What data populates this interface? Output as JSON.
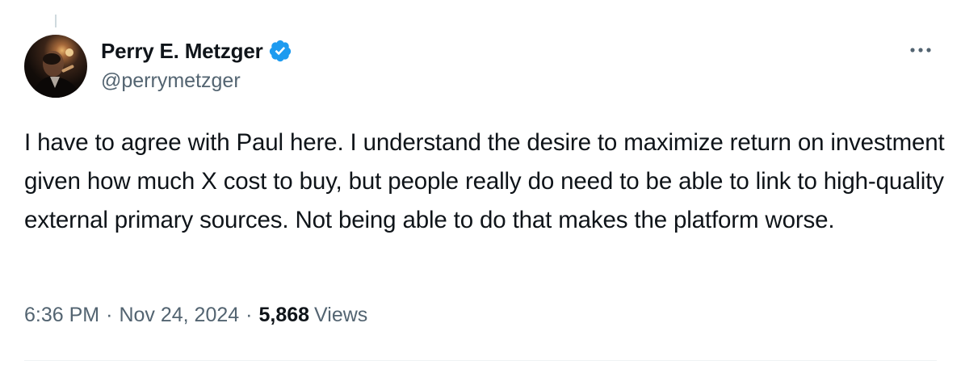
{
  "author": {
    "display_name": "Perry E. Metzger",
    "handle": "@perrymetzger",
    "verified_icon": "verified-badge-icon",
    "verified_color": "#1d9bf0",
    "avatar_icon": "user-avatar"
  },
  "menu": {
    "more_icon": "more-horizontal-icon"
  },
  "tweet": {
    "text": "I have to agree with Paul here. I understand the desire to maximize return on investment given how much X cost to buy, but people really do need to be able to link to high-quality external primary sources. Not being able to do that makes the platform worse."
  },
  "meta": {
    "time": "6:36 PM",
    "separator": "·",
    "date": "Nov 24, 2024",
    "views_count": "5,868",
    "views_label": "Views"
  }
}
